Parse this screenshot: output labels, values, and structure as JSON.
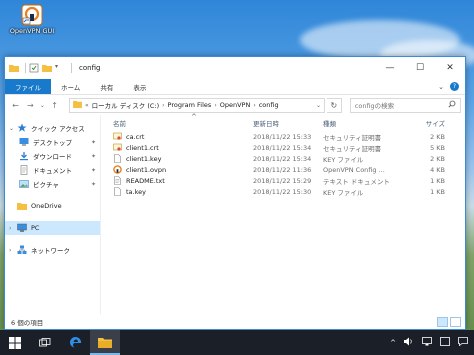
{
  "desktop": {
    "icon_label": "OpenVPN GUI"
  },
  "window": {
    "title": "config",
    "controls": {
      "minimize": "—",
      "maximize": "☐",
      "close": "✕"
    }
  },
  "ribbon": {
    "tabs": [
      "ファイル",
      "ホーム",
      "共有",
      "表示"
    ],
    "expand": "⌄",
    "help": "?"
  },
  "address": {
    "back": "←",
    "forward": "→",
    "recent": "⌄",
    "up": "↑",
    "prefix": "«",
    "crumbs": [
      "ローカル ディスク (C:)",
      "Program Files",
      "OpenVPN",
      "config"
    ],
    "dropdown": "⌄",
    "refresh": "↻"
  },
  "search": {
    "placeholder": "configの検索",
    "icon": "search-icon"
  },
  "nav": {
    "items": [
      {
        "label": "クイック アクセス",
        "type": "quick"
      },
      {
        "label": "デスクトップ",
        "type": "desktop",
        "pinned": true
      },
      {
        "label": "ダウンロード",
        "type": "download",
        "pinned": true
      },
      {
        "label": "ドキュメント",
        "type": "document",
        "pinned": true
      },
      {
        "label": "ピクチャ",
        "type": "picture",
        "pinned": true
      },
      {
        "label": "OneDrive",
        "type": "onedrive"
      },
      {
        "label": "PC",
        "type": "pc"
      },
      {
        "label": "ネットワーク",
        "type": "network"
      }
    ],
    "pin_glyph": "📌"
  },
  "columns": {
    "name": "名前",
    "date": "更新日時",
    "type": "種類",
    "size": "サイズ",
    "collapse": "^"
  },
  "files": [
    {
      "name": "ca.crt",
      "date": "2018/11/22 15:33",
      "type": "セキュリティ証明書",
      "size": "2 KB",
      "icon": "certificate-icon"
    },
    {
      "name": "client1.crt",
      "date": "2018/11/22 15:34",
      "type": "セキュリティ証明書",
      "size": "5 KB",
      "icon": "certificate-icon"
    },
    {
      "name": "client1.key",
      "date": "2018/11/22 15:34",
      "type": "KEY ファイル",
      "size": "2 KB",
      "icon": "file-icon"
    },
    {
      "name": "client1.ovpn",
      "date": "2018/11/22 11:36",
      "type": "OpenVPN Config ...",
      "size": "4 KB",
      "icon": "openvpn-icon"
    },
    {
      "name": "README.txt",
      "date": "2018/11/22 15:29",
      "type": "テキスト ドキュメント",
      "size": "1 KB",
      "icon": "text-file-icon"
    },
    {
      "name": "ta.key",
      "date": "2018/11/22 15:30",
      "type": "KEY ファイル",
      "size": "1 KB",
      "icon": "file-icon"
    }
  ],
  "status": {
    "count": "6 個の項目"
  },
  "colors": {
    "accent": "#1979ca",
    "selection": "#cce8ff",
    "taskbar": "#1b1f28"
  }
}
